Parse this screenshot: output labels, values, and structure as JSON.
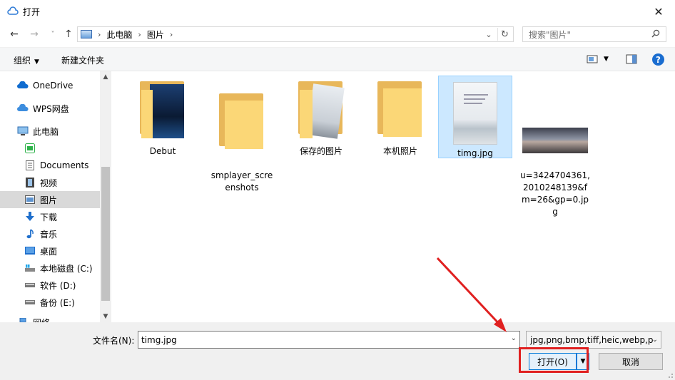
{
  "window": {
    "title": "打开",
    "close_glyph": "✕"
  },
  "navbar": {
    "back_glyph": "←",
    "forward_glyph": "→",
    "recent_glyph": "˅",
    "up_glyph": "↑",
    "breadcrumb": [
      "此电脑",
      "图片"
    ],
    "separator": "›",
    "dropdown_glyph": "⌄",
    "refresh_glyph": "↻",
    "search_placeholder": "搜索\"图片\""
  },
  "toolbar": {
    "organize_label": "组织",
    "new_folder_label": "新建文件夹",
    "arrow_glyph": "▼",
    "help_label": "?"
  },
  "sidebar": {
    "items": [
      {
        "label": "OneDrive",
        "icon": "cloud-icon"
      },
      {
        "label": "WPS网盘",
        "icon": "wps-cloud-icon"
      },
      {
        "label": "此电脑",
        "icon": "computer-icon"
      },
      {
        "label": "",
        "icon": "wps-app-icon"
      },
      {
        "label": "Documents",
        "icon": "documents-icon"
      },
      {
        "label": "视频",
        "icon": "video-icon"
      },
      {
        "label": "图片",
        "icon": "pictures-icon",
        "selected": true
      },
      {
        "label": "下载",
        "icon": "download-icon"
      },
      {
        "label": "音乐",
        "icon": "music-icon"
      },
      {
        "label": "桌面",
        "icon": "desktop-icon"
      },
      {
        "label": "本地磁盘 (C:)",
        "icon": "drive-c-icon"
      },
      {
        "label": "软件 (D:)",
        "icon": "drive-icon"
      },
      {
        "label": "备份 (E:)",
        "icon": "drive-icon"
      },
      {
        "label": "网络",
        "icon": "network-icon"
      }
    ],
    "scroll_up_glyph": "▲",
    "scroll_down_glyph": "▼"
  },
  "files": [
    {
      "name": "Debut",
      "kind": "folder"
    },
    {
      "name": "smplayer_scre\nenshots",
      "kind": "folder"
    },
    {
      "name": "保存的图片",
      "kind": "folder"
    },
    {
      "name": "本机照片",
      "kind": "folder"
    },
    {
      "name": "timg.jpg",
      "kind": "image",
      "selected": true
    },
    {
      "name": "u=3424704361,\n2010248139&f\nm=26&gp=0.jp\ng",
      "kind": "image"
    }
  ],
  "bottom": {
    "filename_label": "文件名(N):",
    "filename_value": "timg.jpg",
    "filetype_value": "jpg,png,bmp,tiff,heic,webp,p",
    "open_label": "打开(O)",
    "cancel_label": "取消",
    "drop_glyph": "⌄",
    "split_glyph": "▼"
  },
  "colors": {
    "accent": "#0078d7",
    "selection": "#cce8ff",
    "annotation": "#e02020",
    "folder": "#fbd777"
  }
}
